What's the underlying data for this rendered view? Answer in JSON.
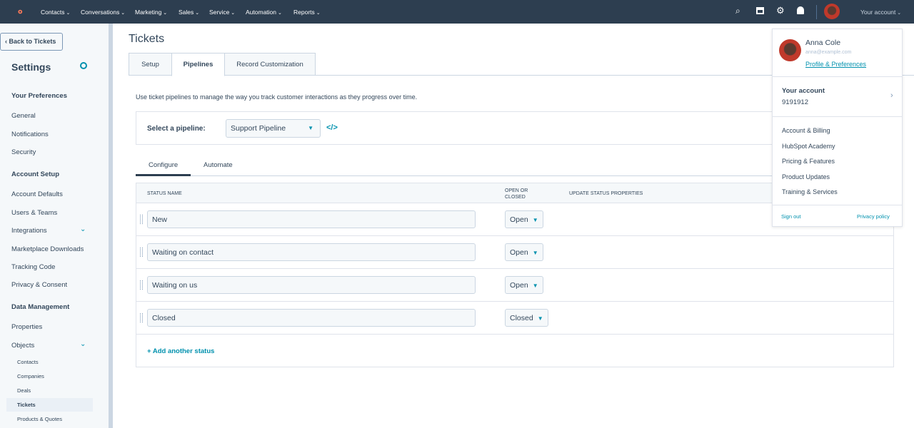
{
  "nav": {
    "items": [
      "Contacts",
      "Conversations",
      "Marketing",
      "Sales",
      "Service",
      "Automation",
      "Reports"
    ],
    "account": "Your account"
  },
  "sidebar": {
    "back": "Back to Tickets",
    "title": "Settings",
    "items": [
      {
        "t": "h",
        "l": "Your Preferences"
      },
      {
        "t": "i",
        "l": "General"
      },
      {
        "t": "i",
        "l": "Notifications"
      },
      {
        "t": "i",
        "l": "Security"
      },
      {
        "t": "h",
        "l": "Account Setup"
      },
      {
        "t": "i",
        "l": "Account Defaults"
      },
      {
        "t": "i",
        "l": "Users & Teams"
      },
      {
        "t": "i",
        "l": "Integrations"
      },
      {
        "t": "i",
        "l": "Marketplace Downloads"
      },
      {
        "t": "i",
        "l": "Tracking Code"
      },
      {
        "t": "i",
        "l": "Privacy & Consent"
      },
      {
        "t": "h",
        "l": "Data Management"
      },
      {
        "t": "i",
        "l": "Properties"
      },
      {
        "t": "i",
        "l": "Objects"
      },
      {
        "t": "s",
        "l": "Contacts"
      },
      {
        "t": "s",
        "l": "Companies"
      },
      {
        "t": "s",
        "l": "Deals"
      },
      {
        "t": "s",
        "l": "Tickets"
      },
      {
        "t": "s",
        "l": "Products & Quotes"
      }
    ]
  },
  "main": {
    "title": "Tickets",
    "tabs": [
      "Setup",
      "Pipelines",
      "Record Customization"
    ],
    "description": "Use ticket pipelines to manage the way you track customer interactions as they progress over time.",
    "pipeline_label": "Select a pipeline:",
    "pipeline_value": "Support Pipeline",
    "subtabs": [
      "Configure",
      "Automate"
    ],
    "columns": [
      "STATUS NAME",
      "OPEN OR CLOSED",
      "UPDATE STATUS PROPERTIES"
    ],
    "rows": [
      {
        "name": "New",
        "state": "Open"
      },
      {
        "name": "Waiting on contact",
        "state": "Open"
      },
      {
        "name": "Waiting on us",
        "state": "Open"
      },
      {
        "name": "Closed",
        "state": "Closed"
      }
    ],
    "add_status": "Add another status"
  },
  "account_menu": {
    "name": "Anna Cole",
    "email": "anna@example.com",
    "profile_link": "Profile & Preferences",
    "account_label": "Your account",
    "account_id": "9191912",
    "links": [
      "Account & Billing",
      "HubSpot Academy",
      "Pricing & Features",
      "Product Updates",
      "Training & Services"
    ],
    "sign_out": "Sign out",
    "privacy": "Privacy policy"
  }
}
